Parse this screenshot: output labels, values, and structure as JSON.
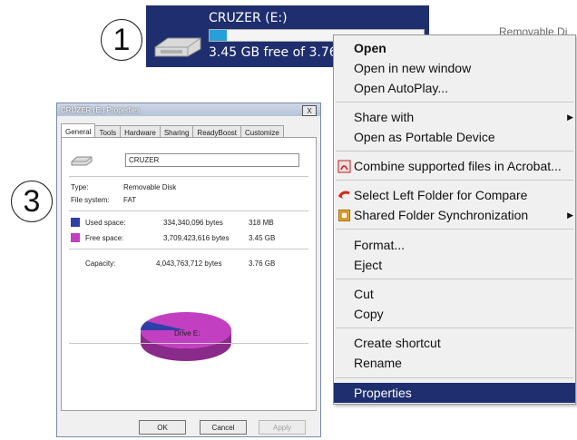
{
  "badges": {
    "step1": "1",
    "step3": "3"
  },
  "drive_tile": {
    "name": "CRUZER (E:)",
    "free_text": "3.45 GB free of 3.76 GB",
    "used_fraction": 0.08,
    "behind_label": "Removable Di"
  },
  "context_menu": {
    "items": [
      {
        "label": "Open",
        "bold": true
      },
      {
        "label": "Open in new window"
      },
      {
        "label": "Open AutoPlay..."
      },
      {
        "label": "Share with",
        "submenu": true
      },
      {
        "label": "Open as Portable Device"
      },
      {
        "label": "Combine supported files in Acrobat...",
        "icon": "acrobat-icon"
      },
      {
        "label": "Select Left Folder for Compare",
        "icon": "compare-icon"
      },
      {
        "label": "Shared Folder Synchronization",
        "icon": "sync-icon",
        "submenu": true
      },
      {
        "label": "Format..."
      },
      {
        "label": "Eject"
      },
      {
        "label": "Cut"
      },
      {
        "label": "Copy"
      },
      {
        "label": "Create shortcut"
      },
      {
        "label": "Rename"
      },
      {
        "label": "Properties",
        "selected": true
      }
    ],
    "submenu_arrow": "▶"
  },
  "dialog": {
    "title": "CRUZER (E:) Properties",
    "close_glyph": "X",
    "tabs": [
      "General",
      "Tools",
      "Hardware",
      "Sharing",
      "ReadyBoost",
      "Customize"
    ],
    "active_tab": "General",
    "label_value": "CRUZER",
    "type_label": "Type:",
    "type_value": "Removable Disk",
    "fs_label": "File system:",
    "fs_value": "FAT",
    "used": {
      "label": "Used space:",
      "bytes": "334,340,096 bytes",
      "size": "318 MB",
      "color": "#2e3fa8"
    },
    "free": {
      "label": "Free space:",
      "bytes": "3,709,423,616 bytes",
      "size": "3.45 GB",
      "color": "#c23fc2"
    },
    "capacity": {
      "label": "Capacity:",
      "bytes": "4,043,763,712 bytes",
      "size": "3.76 GB"
    },
    "drive_caption": "Drive E:",
    "buttons": {
      "ok": "OK",
      "cancel": "Cancel",
      "apply": "Apply"
    }
  }
}
